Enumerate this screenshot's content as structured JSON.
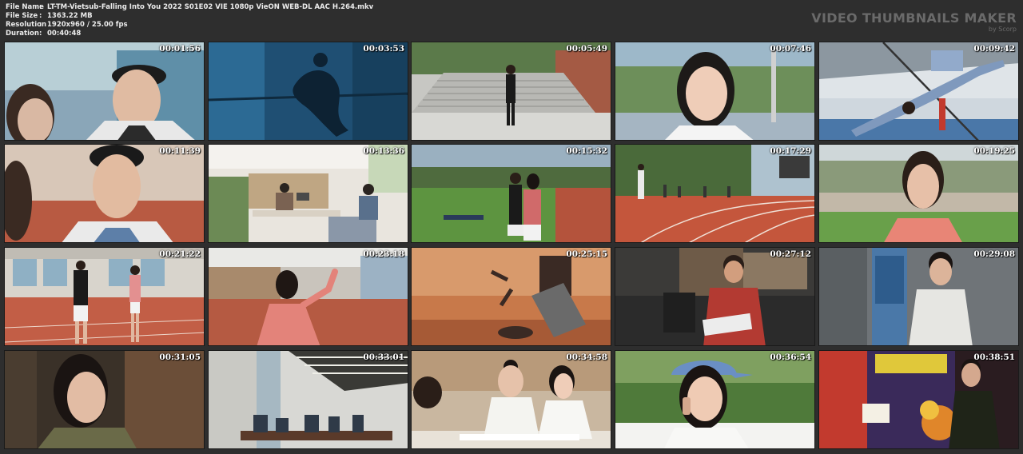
{
  "file_info": {
    "rows": [
      {
        "key": "File Name",
        "value": "LT-TM-Vietsub-Falling Into You 2022 S01E02 VIE 1080p VieON WEB-DL AAC H.264.mkv"
      },
      {
        "key": "File Size",
        "value": "1363.22 MB"
      },
      {
        "key": "Resolution",
        "value": "1920x960 / 25.00 fps"
      },
      {
        "key": "Duration",
        "value": "00:40:48"
      }
    ],
    "separator": ":"
  },
  "brand": {
    "title": "VIDEO THUMBNAILS MAKER",
    "subtitle": "by Scorp"
  },
  "thumbnails": [
    {
      "time": "00:01:56",
      "scene": "close-up-two-faces"
    },
    {
      "time": "00:03:53",
      "scene": "silhouette-high-jump-blue"
    },
    {
      "time": "00:05:49",
      "scene": "girl-on-stadium-steps"
    },
    {
      "time": "00:07:46",
      "scene": "smiling-woman-outdoors"
    },
    {
      "time": "00:09:42",
      "scene": "high-jumper-over-bar"
    },
    {
      "time": "00:11:39",
      "scene": "young-man-on-track"
    },
    {
      "time": "00:13:36",
      "scene": "office-with-desks"
    },
    {
      "time": "00:15:32",
      "scene": "athletes-on-field"
    },
    {
      "time": "00:17:29",
      "scene": "running-track-palms"
    },
    {
      "time": "00:19:25",
      "scene": "woman-in-pink-on-field"
    },
    {
      "time": "00:21:22",
      "scene": "pair-on-indoor-track"
    },
    {
      "time": "00:23:18",
      "scene": "girl-waving-indoor-hall"
    },
    {
      "time": "00:25:15",
      "scene": "blurred-jump-warm"
    },
    {
      "time": "00:27:12",
      "scene": "man-reading-on-sofa"
    },
    {
      "time": "00:29:08",
      "scene": "man-in-hoodie-hallway"
    },
    {
      "time": "00:31:05",
      "scene": "woman-in-library"
    },
    {
      "time": "00:33:01",
      "scene": "library-reading-room"
    },
    {
      "time": "00:34:58",
      "scene": "students-studying"
    },
    {
      "time": "00:36:54",
      "scene": "woman-in-cap-on-phone"
    },
    {
      "time": "00:38:51",
      "scene": "arcade-machine"
    }
  ],
  "colors": {
    "background": "#2e2e2e",
    "text": "#ececec",
    "brand_text": "#6a6a6a"
  }
}
